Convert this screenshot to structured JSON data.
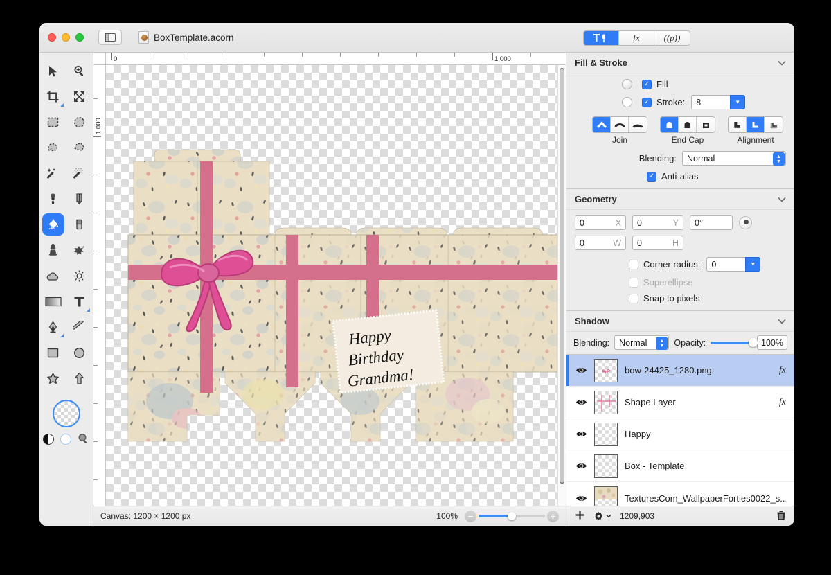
{
  "window": {
    "title": "BoxTemplate.acorn",
    "traffic_lights": [
      "close",
      "minimize",
      "zoom"
    ],
    "sidebar_toggle_icon": "sidebar-toggle-icon",
    "doc_icon": "acorn-document-icon"
  },
  "mode_switch": {
    "segments": [
      {
        "id": "tools",
        "label": "",
        "icon": "hammer-brush-icon",
        "active": true
      },
      {
        "id": "filters",
        "label": "fx",
        "icon": "fx-icon",
        "active": false
      },
      {
        "id": "palettes",
        "label": "((p))",
        "icon": "palette-icon",
        "active": false
      }
    ]
  },
  "tools": {
    "items": [
      {
        "name": "move-tool",
        "icon": "arrow-cursor-icon",
        "selected": false
      },
      {
        "name": "zoom-tool",
        "icon": "magnifier-plus-icon",
        "selected": false
      },
      {
        "name": "crop-tool",
        "icon": "crop-icon",
        "selected": false,
        "corner": true
      },
      {
        "name": "transform-tool",
        "icon": "move-arrows-icon",
        "selected": false
      },
      {
        "name": "rectangular-select-tool",
        "icon": "marquee-rect-icon",
        "selected": false
      },
      {
        "name": "elliptical-select-tool",
        "icon": "marquee-ellipse-icon",
        "selected": false
      },
      {
        "name": "lasso-tool",
        "icon": "lasso-icon",
        "selected": false
      },
      {
        "name": "polygon-lasso-tool",
        "icon": "polygon-lasso-icon",
        "selected": false
      },
      {
        "name": "magic-wand-tool",
        "icon": "magic-wand-icon",
        "selected": false
      },
      {
        "name": "select-similar-tool",
        "icon": "dotted-wand-icon",
        "selected": false
      },
      {
        "name": "brush-tool",
        "icon": "paintbrush-icon",
        "selected": false
      },
      {
        "name": "pencil-tool",
        "icon": "pencil-icon",
        "selected": false
      },
      {
        "name": "paint-bucket-tool",
        "icon": "paint-bucket-icon",
        "selected": true
      },
      {
        "name": "eraser-tool",
        "icon": "eraser-icon",
        "selected": false
      },
      {
        "name": "clone-stamp-tool",
        "icon": "clone-stamp-icon",
        "selected": false
      },
      {
        "name": "smudge-tool",
        "icon": "smudge-splat-icon",
        "selected": false
      },
      {
        "name": "blur-tool",
        "icon": "cloud-icon",
        "selected": false
      },
      {
        "name": "dodge-burn-tool",
        "icon": "sun-icon",
        "selected": false
      },
      {
        "name": "gradient-tool",
        "icon": "gradient-icon",
        "selected": false
      },
      {
        "name": "text-tool",
        "icon": "text-t-icon",
        "selected": false,
        "corner": true
      },
      {
        "name": "bezier-pen-tool",
        "icon": "fountain-pen-icon",
        "selected": false,
        "corner": true
      },
      {
        "name": "line-tool",
        "icon": "line-icon",
        "selected": false
      },
      {
        "name": "rectangle-tool",
        "icon": "rectangle-icon",
        "selected": false
      },
      {
        "name": "ellipse-tool",
        "icon": "ellipse-icon",
        "selected": false
      },
      {
        "name": "star-tool",
        "icon": "star-icon",
        "selected": false
      },
      {
        "name": "arrow-shape-tool",
        "icon": "arrow-shape-icon",
        "selected": false
      }
    ],
    "color_well": "transparent-color-well",
    "swap_colors": "black-white-colors-icon",
    "reset_colors": "clear-color-icon",
    "loupe": "magnifier-icon"
  },
  "rulers": {
    "horizontal_labels": [
      "0",
      "1,000"
    ],
    "vertical_labels": [
      "1,000"
    ],
    "unit": "px"
  },
  "canvas": {
    "artwork_alt": "gift-box-template-floral-with-pink-ribbon-and-bow",
    "card_text_lines": [
      "Happy",
      "Birthday",
      "Grandma!"
    ],
    "ribbon_color": "#d4708c",
    "bow_color": "#e84e9a",
    "paper_color": "#eadfc4"
  },
  "statusbar": {
    "canvas_label": "Canvas: 1200 × 1200 px",
    "zoom_level": "100%",
    "zoom_out_icon": "zoom-out-icon",
    "zoom_in_icon": "zoom-in-icon"
  },
  "inspector": {
    "fill_stroke": {
      "title": "Fill & Stroke",
      "collapse_icon": "chevron-down-icon",
      "fill": {
        "label": "Fill",
        "checked": true,
        "radio_selected": false
      },
      "stroke": {
        "label": "Stroke:",
        "checked": true,
        "radio_selected": false,
        "value": "8"
      },
      "join": {
        "caption": "Join",
        "options": [
          "miter-join",
          "round-join",
          "bevel-join"
        ],
        "selected_index": 0
      },
      "end_cap": {
        "caption": "End Cap",
        "options": [
          "butt-cap",
          "round-cap",
          "square-cap"
        ],
        "selected_index": 0
      },
      "alignment": {
        "caption": "Alignment",
        "options": [
          "align-inside",
          "align-center",
          "align-outside"
        ],
        "selected_index": 1
      },
      "blending": {
        "label": "Blending:",
        "value": "Normal"
      },
      "anti_alias": {
        "label": "Anti-alias",
        "checked": true
      }
    },
    "geometry": {
      "title": "Geometry",
      "collapse_icon": "chevron-down-icon",
      "x": {
        "value": "0",
        "unit": "X"
      },
      "y": {
        "value": "0",
        "unit": "Y"
      },
      "rotation": {
        "value": "0°"
      },
      "w": {
        "value": "0",
        "unit": "W"
      },
      "h": {
        "value": "0",
        "unit": "H"
      },
      "corner_radius": {
        "label": "Corner radius:",
        "checked": false,
        "value": "0"
      },
      "superellipse": {
        "label": "Superellipse",
        "checked": false,
        "disabled": true
      },
      "snap_to_pixels": {
        "label": "Snap to pixels",
        "checked": false
      }
    },
    "shadow": {
      "title": "Shadow",
      "collapse_icon": "chevron-down-icon",
      "blending": {
        "label": "Blending:",
        "value": "Normal"
      },
      "opacity": {
        "label": "Opacity:",
        "value": "100%",
        "percent": 100
      }
    }
  },
  "layers": {
    "items": [
      {
        "name": "bow-24425_1280.png",
        "visible": true,
        "selected": true,
        "has_fx": true,
        "thumb": "bow-thumb"
      },
      {
        "name": "Shape Layer",
        "visible": true,
        "selected": false,
        "has_fx": true,
        "thumb": "ribbon-cross-thumb"
      },
      {
        "name": "Happy",
        "visible": true,
        "selected": false,
        "has_fx": false,
        "thumb": "empty-thumb"
      },
      {
        "name": "Box - Template",
        "visible": true,
        "selected": false,
        "has_fx": false,
        "thumb": "empty-thumb"
      },
      {
        "name": "TexturesCom_WallpaperForties0022_s...",
        "visible": true,
        "selected": false,
        "has_fx": false,
        "thumb": "texture-thumb"
      }
    ],
    "toolbar": {
      "add_icon": "plus-icon",
      "settings_icon": "gear-icon",
      "memory": "1209,903",
      "delete_icon": "trash-icon"
    }
  }
}
